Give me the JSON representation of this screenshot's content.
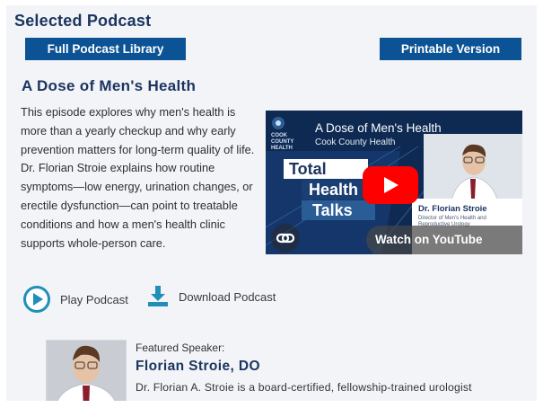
{
  "section": {
    "title": "Selected Podcast"
  },
  "buttons": {
    "library_label": "Full Podcast Library",
    "print_label": "Printable Version"
  },
  "episode": {
    "title": "A Dose of Men's Health",
    "description": "This episode explores why men's health is more than a yearly checkup and why early prevention matters for long-term quality of life. Dr. Florian Stroie explains how routine symptoms—low energy, urination changes, or erectile dysfunction—can point to treatable conditions and how a men's health clinic supports whole-person care."
  },
  "video": {
    "logo_text": "COOK COUNTY HEALTH",
    "title": "A Dose of Men's Health",
    "subtitle": "Cook County Health",
    "badge_line1": "Total",
    "badge_line2": "Health",
    "badge_line3": "Talks",
    "speaker_name": "Dr. Florian Stroie",
    "speaker_role": "Director of Men's Health and Reproductive Urology",
    "watch_label": "Watch on YouTube",
    "share_icon": "link-icon",
    "play_icon": "youtube-play-icon"
  },
  "actions": {
    "play_label": "Play Podcast",
    "download_label": "Download Podcast"
  },
  "speaker": {
    "kicker": "Featured Speaker:",
    "name": "Florian Stroie, DO",
    "bio": "Dr. Florian A. Stroie is a board-certified, fellowship-trained urologist"
  },
  "colors": {
    "brand_navy": "#1b3560",
    "button_blue": "#0b5394",
    "accent_teal": "#1f8fb8",
    "youtube_red": "#ff0000"
  }
}
